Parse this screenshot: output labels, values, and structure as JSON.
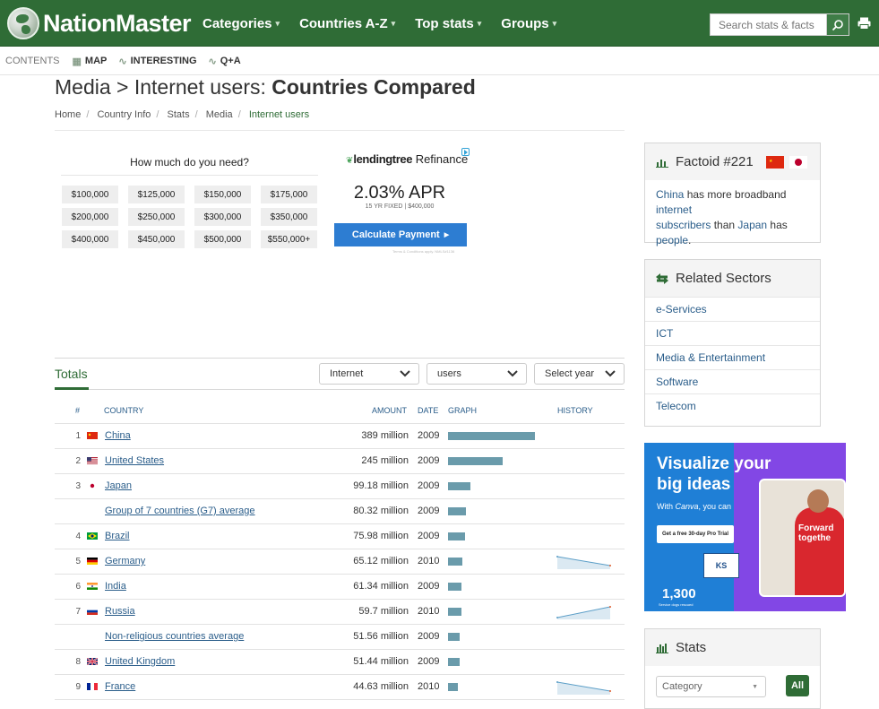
{
  "header": {
    "logo": "NationMaster",
    "menu": [
      {
        "label": "Categories"
      },
      {
        "label": "Countries A-Z"
      },
      {
        "label": "Top stats"
      },
      {
        "label": "Groups"
      }
    ],
    "search_placeholder": "Search stats & facts"
  },
  "subnav": {
    "contents": "CONTENTS",
    "items": [
      {
        "label": "MAP",
        "icon": "map-icon"
      },
      {
        "label": "INTERESTING",
        "icon": "trend-icon"
      },
      {
        "label": "Q+A",
        "icon": "trend-icon"
      }
    ]
  },
  "page": {
    "title_prefix": "Media > Internet users: ",
    "title_bold": "Countries Compared",
    "breadcrumb": [
      "Home",
      "Country Info",
      "Stats",
      "Media",
      "Internet users"
    ]
  },
  "ad": {
    "question": "How much do you need?",
    "amounts": [
      "$100,000",
      "$125,000",
      "$150,000",
      "$175,000",
      "$200,000",
      "$250,000",
      "$300,000",
      "$350,000",
      "$400,000",
      "$450,000",
      "$500,000",
      "$550,000+"
    ],
    "brand": "lendingtree",
    "product": "Refinance",
    "apr": "2.03% APR",
    "apr_sub": "15 YR FIXED | $400,000",
    "cta": "Calculate Payment",
    "fine": "Terms & Conditions apply. NMLS#1136"
  },
  "filters": {
    "tab": "Totals",
    "selects": [
      "Internet",
      "users",
      "Select year"
    ]
  },
  "table": {
    "headers": {
      "rank": "#",
      "country": "COUNTRY",
      "amount": "AMOUNT",
      "date": "DATE",
      "graph": "GRAPH",
      "history": "HISTORY"
    },
    "rows": [
      {
        "rank": "1",
        "country": "China",
        "flag": "cn",
        "amount": "389 million",
        "date": "2009",
        "value": 389,
        "history": null
      },
      {
        "rank": "2",
        "country": "United States",
        "flag": "us",
        "amount": "245 million",
        "date": "2009",
        "value": 245,
        "history": null
      },
      {
        "rank": "3",
        "country": "Japan",
        "flag": "jp",
        "amount": "99.18 million",
        "date": "2009",
        "value": 99.18,
        "history": null
      },
      {
        "rank": "",
        "country": "Group of 7 countries (G7) average",
        "flag": "",
        "amount": "80.32 million",
        "date": "2009",
        "value": 80.32,
        "history": null
      },
      {
        "rank": "4",
        "country": "Brazil",
        "flag": "br",
        "amount": "75.98 million",
        "date": "2009",
        "value": 75.98,
        "history": null
      },
      {
        "rank": "5",
        "country": "Germany",
        "flag": "de",
        "amount": "65.12 million",
        "date": "2010",
        "value": 65.12,
        "history": "down"
      },
      {
        "rank": "6",
        "country": "India",
        "flag": "in",
        "amount": "61.34 million",
        "date": "2009",
        "value": 61.34,
        "history": null
      },
      {
        "rank": "7",
        "country": "Russia",
        "flag": "ru",
        "amount": "59.7 million",
        "date": "2010",
        "value": 59.7,
        "history": "up"
      },
      {
        "rank": "",
        "country": "Non-religious countries average",
        "flag": "",
        "amount": "51.56 million",
        "date": "2009",
        "value": 51.56,
        "history": null
      },
      {
        "rank": "8",
        "country": "United Kingdom",
        "flag": "gb",
        "amount": "51.44 million",
        "date": "2009",
        "value": 51.44,
        "history": null
      },
      {
        "rank": "9",
        "country": "France",
        "flag": "fr",
        "amount": "44.63 million",
        "date": "2010",
        "value": 44.63,
        "history": "down"
      }
    ]
  },
  "factoid": {
    "title": "Factoid #221",
    "subject": "China",
    "t1": " has more broadband ",
    "link1": "internet",
    "link2": "subscribers",
    "t2": " than ",
    "object": "Japan",
    "t3": " has ",
    "link3": "people",
    "t4": "."
  },
  "related": {
    "title": "Related Sectors",
    "items": [
      "e-Services",
      "ICT",
      "Media & Entertainment",
      "Software",
      "Telecom"
    ]
  },
  "canva_ad": {
    "line1": "Visualize your",
    "line2": "big ideas",
    "sub_prefix": "With ",
    "sub_brand": "Canva",
    "sub_suffix": ", you can",
    "cta": "Get a free 30-day Pro Trial",
    "photo_text1": "Forward",
    "photo_text2": "togethe",
    "logo": "KS",
    "stat": "1,300",
    "stat_caption": "Service dogs rescued"
  },
  "stats": {
    "title": "Stats",
    "category": "Category",
    "all": "All"
  },
  "colors": {
    "brand_green": "#2f6c36",
    "link": "#2a5d8a",
    "bar": "#6a9bab"
  }
}
